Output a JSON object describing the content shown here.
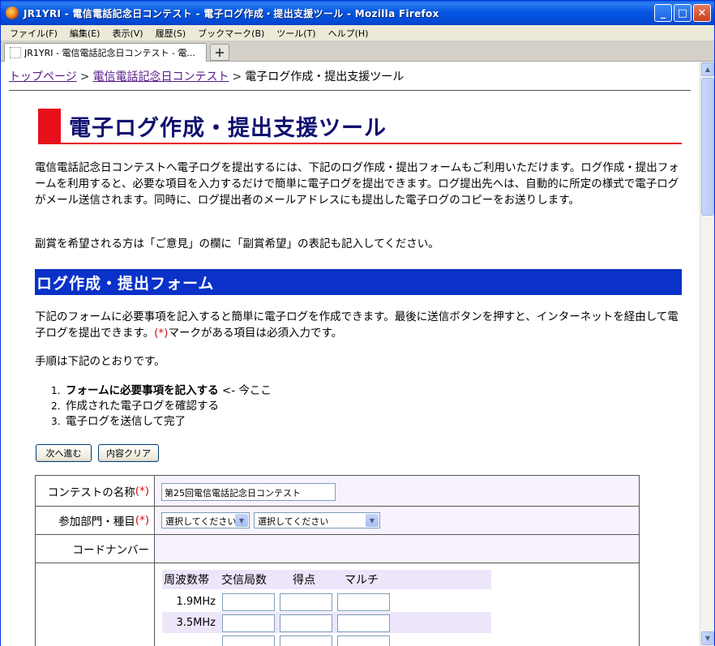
{
  "window": {
    "title": "JR1YRI - 電信電話記念日コンテスト - 電子ログ作成・提出支援ツール - Mozilla Firefox",
    "controls": {
      "minimize": "_",
      "maximize": "□",
      "close": "✕"
    }
  },
  "menu": [
    "ファイル(F)",
    "編集(E)",
    "表示(V)",
    "履歴(S)",
    "ブックマーク(B)",
    "ツール(T)",
    "ヘルプ(H)"
  ],
  "tab": {
    "label": "JR1YRI - 電信電話記念日コンテスト - 電...",
    "new_tab": "+"
  },
  "breadcrumb": {
    "top": "トップページ",
    "contest": "電信電話記念日コンテスト",
    "current": "電子ログ作成・提出支援ツール",
    "sep": ">"
  },
  "page": {
    "title": "電子ログ作成・提出支援ツール",
    "intro": "電信電話記念日コンテストへ電子ログを提出するには、下記のログ作成・提出フォームもご利用いただけます。ログ作成・提出フォームを利用すると、必要な項目を入力するだけで簡単に電子ログを提出できます。ログ提出先へは、自動的に所定の様式で電子ログがメール送信されます。同時に、ログ提出者のメールアドレスにも提出した電子ログのコピーをお送りします。",
    "note": "副賞を希望される方は「ご意見」の欄に「副賞希望」の表記も記入してください。",
    "section_title": "ログ作成・提出フォーム",
    "desc_a": "下記のフォームに必要事項を記入すると簡単に電子ログを作成できます。最後に送信ボタンを押すと、インターネットを経由して電子ログを提出できます。",
    "required_mark": "(*)",
    "desc_b": "マークがある項目は必須入力です。",
    "steps_intro": "手順は下記のとおりです。",
    "steps": [
      {
        "num": "1.",
        "text": "フォームに必要事項を記入する",
        "suffix": " <- 今ここ"
      },
      {
        "num": "2.",
        "text": "作成された電子ログを確認する"
      },
      {
        "num": "3.",
        "text": "電子ログを送信して完了"
      }
    ],
    "buttons": {
      "next": "次へ進む",
      "clear": "内容クリア"
    }
  },
  "form": {
    "contest_label": "コンテストの名称",
    "contest_value": "第25回電信電話記念日コンテスト",
    "category_label": "参加部門・種目",
    "category_select_1": "選択してください",
    "category_select_2": "選択してください",
    "code_label": "コードナンバー",
    "band_headers": [
      "周波数帯",
      "交信局数",
      "得点",
      "マルチ"
    ],
    "bands": [
      "1.9MHz",
      "3.5MHz"
    ]
  }
}
